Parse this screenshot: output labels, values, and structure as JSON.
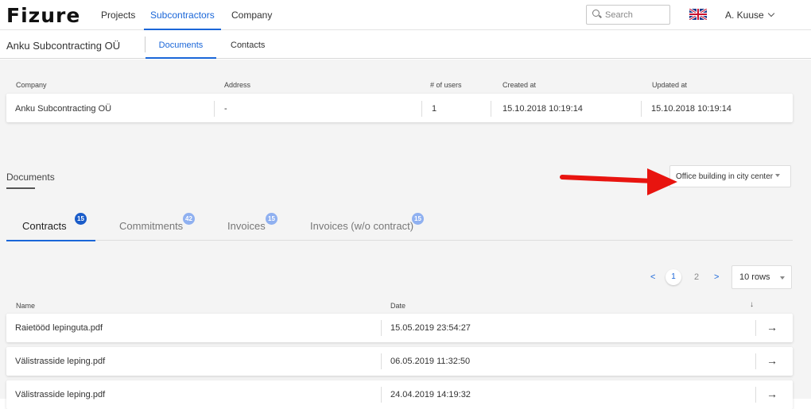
{
  "app": {
    "logo": "Fizure"
  },
  "nav": {
    "projects": "Projects",
    "subcontractors": "Subcontractors",
    "company": "Company"
  },
  "search": {
    "placeholder": "Search"
  },
  "user": {
    "name": "A. Kuuse"
  },
  "subheader": {
    "title": "Anku Subcontracting OÜ",
    "tab_documents": "Documents",
    "tab_contacts": "Contacts"
  },
  "company_table": {
    "headers": [
      "Company",
      "Address",
      "# of users",
      "Created at",
      "Updated at"
    ],
    "row": [
      "Anku Subcontracting OÜ",
      "-",
      "1",
      "15.10.2018 10:19:14",
      "15.10.2018 10:19:14"
    ]
  },
  "documents": {
    "label": "Documents",
    "project_select": "Office building in city center",
    "tabs": [
      {
        "label": "Contracts",
        "count": "15"
      },
      {
        "label": "Commitments",
        "count": "42"
      },
      {
        "label": "Invoices",
        "count": "15"
      },
      {
        "label": "Invoices (w/o contract)",
        "count": "15"
      }
    ],
    "pagination": {
      "prev": "<",
      "current": "1",
      "next_page": "2",
      "next": ">",
      "rows": "10 rows"
    },
    "table": {
      "headers": {
        "name": "Name",
        "date": "Date",
        "sort": "↓"
      },
      "rows": [
        {
          "name": "Raietööd lepinguta.pdf",
          "date": "15.05.2019 23:54:27"
        },
        {
          "name": "Välistrasside leping.pdf",
          "date": "06.05.2019 11:32:50"
        },
        {
          "name": "Välistrasside leping.pdf",
          "date": "24.04.2019 14:19:32"
        }
      ],
      "open_icon": "→"
    }
  },
  "colors": {
    "accent": "#1a66d8",
    "annotation_arrow": "#e8140f"
  }
}
